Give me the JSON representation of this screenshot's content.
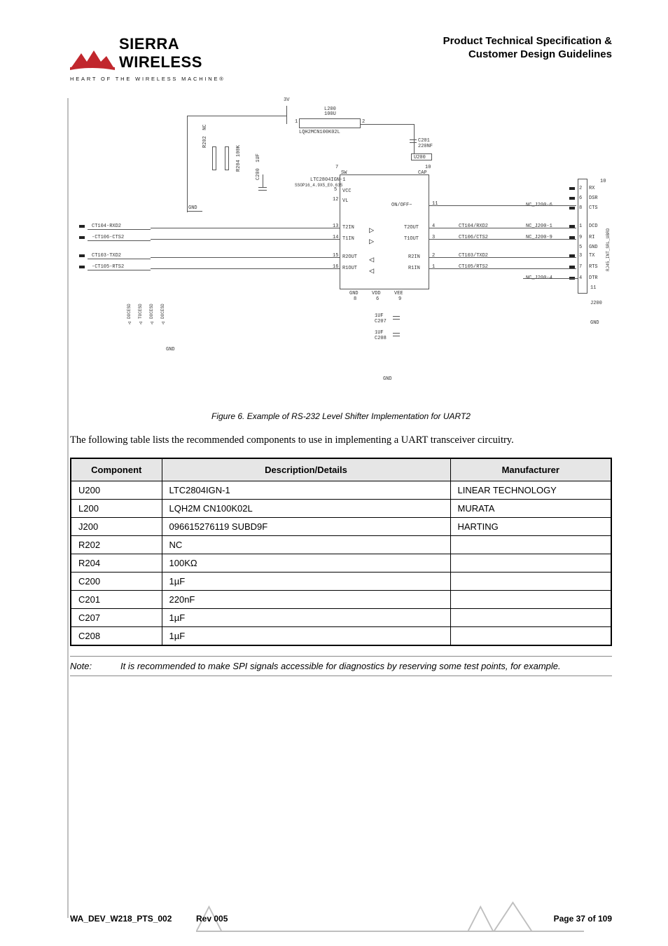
{
  "logo": {
    "name": "SIERRA WIRELESS",
    "tagline": "HEART OF THE WIRELESS MACHINE®"
  },
  "header": {
    "line1": "Product Technical Specification &",
    "line2": "Customer Design Guidelines"
  },
  "schematic": {
    "vrail": "3V",
    "l200": "L200\n100U",
    "l200_pn": "LQH2MCN100K02L",
    "r202": "R202\nNC",
    "r204": "R204\n100K",
    "c200_lbl": "C200\n1UF",
    "gnd_left": "GND",
    "left_signals": [
      "CT104-RXD2",
      "-CT106-CTS2",
      "CT103-TXD2",
      "-CT105-RTS2"
    ],
    "esd": [
      "DOCESD",
      "TOCESD",
      "DOCESD",
      "DOCESD"
    ],
    "chip_title": "LTC2804IGN-1",
    "chip_sub": "SSOP16_4.9X5_E0.635",
    "chip_pins_l": [
      {
        "n": "7",
        "l": "SW"
      },
      {
        "n": "10",
        "l": "CAP"
      },
      {
        "n": "5",
        "l": "VCC"
      },
      {
        "n": "12",
        "l": "VL"
      },
      {
        "n": "13",
        "l": "T2IN"
      },
      {
        "n": "14",
        "l": "T1IN"
      },
      {
        "n": "15",
        "l": "R2OUT"
      },
      {
        "n": "16",
        "l": "R1OUT"
      }
    ],
    "chip_pins_r": [
      {
        "n": "11",
        "l": "ON/OFF~"
      },
      {
        "n": "4",
        "l": "T2OUT"
      },
      {
        "n": "3",
        "l": "T1OUT"
      },
      {
        "n": "2",
        "l": "R2IN"
      },
      {
        "n": "1",
        "l": "R1IN"
      }
    ],
    "chip_bot": [
      {
        "n": "8",
        "l": "GND"
      },
      {
        "n": "6",
        "l": "VDD"
      },
      {
        "n": "9",
        "l": "VEE"
      }
    ],
    "c201": "C201\n220NF",
    "u200": "U200",
    "right_net": [
      "CT104/RXD2",
      "CT106/CTS2",
      "CT103/TXD2",
      "CT105/RTS2"
    ],
    "right_nc": [
      "NC_J200-6",
      "NC_J200-1",
      "NC_J200-9",
      "NC_J200-4"
    ],
    "conn_pins": [
      {
        "n": "10",
        "l": ""
      },
      {
        "n": "2",
        "l": "RX"
      },
      {
        "n": "6",
        "l": "DSR"
      },
      {
        "n": "8",
        "l": "CTS"
      },
      {
        "n": "1",
        "l": "DCD"
      },
      {
        "n": "9",
        "l": "RI"
      },
      {
        "n": "5",
        "l": "GND"
      },
      {
        "n": "3",
        "l": "TX"
      },
      {
        "n": "7",
        "l": "RTS"
      },
      {
        "n": "4",
        "l": "DTR"
      },
      {
        "n": "11",
        "l": ""
      }
    ],
    "conn_name": "J200",
    "conn_side": "RJ45_INT_SRL_UBRD",
    "c207": "1UF\nC207",
    "c208": "1UF\nC208",
    "gnd_bot": "GND",
    "gnd_cbot": "GND",
    "gnd_r": "GND"
  },
  "figure_caption": "Figure 6.   Example of RS-232 Level Shifter Implementation for UART2",
  "intro_text": "The following table lists the recommended components to use in implementing a UART transceiver circuitry.",
  "table": {
    "headers": [
      "Component",
      "Description/Details",
      "Manufacturer"
    ],
    "rows": [
      [
        "U200",
        "LTC2804IGN-1",
        "LINEAR TECHNOLOGY"
      ],
      [
        "L200",
        "LQH2M CN100K02L",
        "MURATA"
      ],
      [
        "J200",
        "096615276119 SUBD9F",
        "HARTING"
      ],
      [
        "R202",
        "NC",
        ""
      ],
      [
        "R204",
        "100KΩ",
        ""
      ],
      [
        "C200",
        "1µF",
        ""
      ],
      [
        "C201",
        "220nF",
        ""
      ],
      [
        "C207",
        "1µF",
        ""
      ],
      [
        "C208",
        "1µF",
        ""
      ]
    ]
  },
  "note": {
    "label": "Note:",
    "text": "It is recommended to make SPI signals accessible for diagnostics by reserving some test points, for example."
  },
  "footer": {
    "doc_id": "WA_DEV_W218_PTS_002",
    "rev": "Rev 005",
    "page": "Page 37 of 109"
  }
}
